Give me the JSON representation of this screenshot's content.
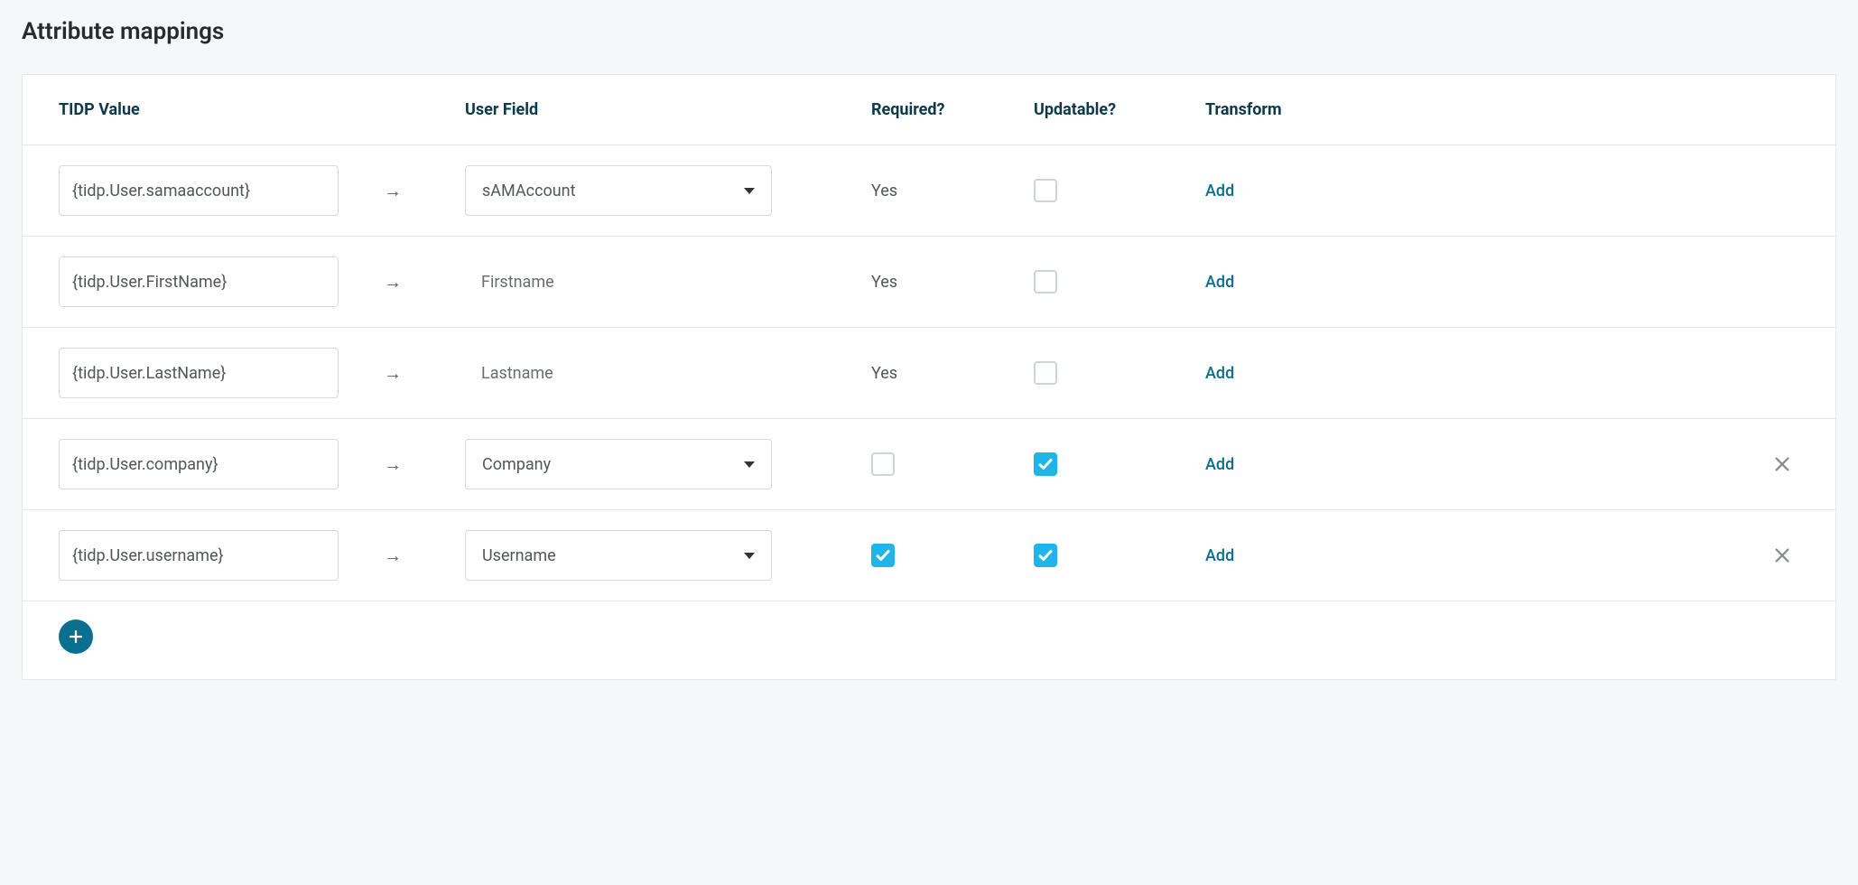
{
  "title": "Attribute mappings",
  "columns": {
    "tidp": "TIDP Value",
    "user": "User Field",
    "required": "Required?",
    "updatable": "Updatable?",
    "transform": "Transform"
  },
  "transform_link_label": "Add",
  "rows": [
    {
      "tidp": "{tidp.User.samaaccount}",
      "user_field": "sAMAccount",
      "user_field_is_select": true,
      "required_display": "Yes",
      "required_is_checkbox": false,
      "required_checked": true,
      "updatable_checked": false,
      "deletable": false
    },
    {
      "tidp": "{tidp.User.FirstName}",
      "user_field": "Firstname",
      "user_field_is_select": false,
      "required_display": "Yes",
      "required_is_checkbox": false,
      "required_checked": true,
      "updatable_checked": false,
      "deletable": false
    },
    {
      "tidp": "{tidp.User.LastName}",
      "user_field": "Lastname",
      "user_field_is_select": false,
      "required_display": "Yes",
      "required_is_checkbox": false,
      "required_checked": true,
      "updatable_checked": false,
      "deletable": false
    },
    {
      "tidp": "{tidp.User.company}",
      "user_field": "Company",
      "user_field_is_select": true,
      "required_display": "",
      "required_is_checkbox": true,
      "required_checked": false,
      "updatable_checked": true,
      "deletable": true
    },
    {
      "tidp": "{tidp.User.username}",
      "user_field": "Username",
      "user_field_is_select": true,
      "required_display": "",
      "required_is_checkbox": true,
      "required_checked": true,
      "updatable_checked": true,
      "deletable": true
    }
  ]
}
